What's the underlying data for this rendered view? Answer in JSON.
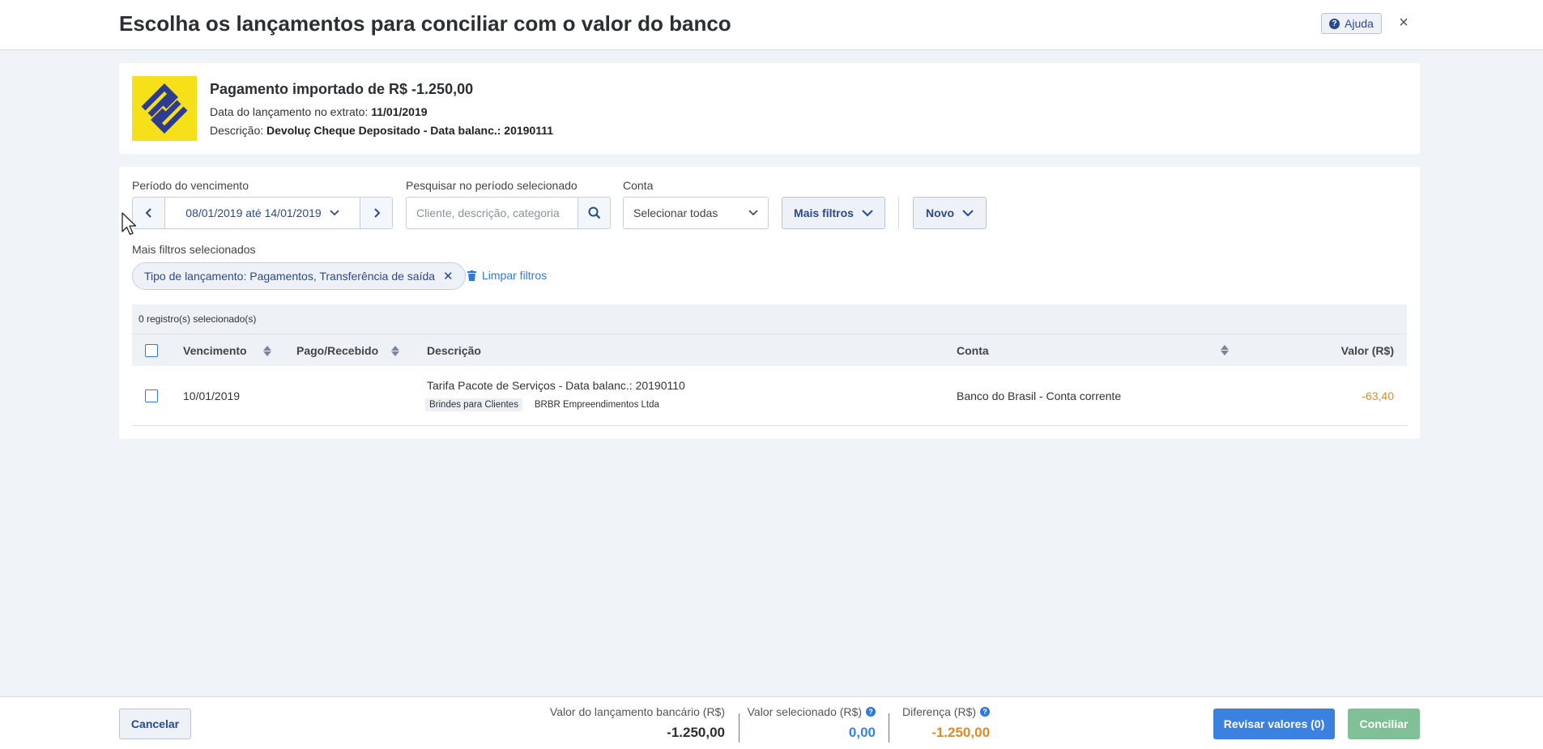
{
  "header": {
    "title": "Escolha os lançamentos para conciliar com o valor do banco",
    "help_label": "Ajuda",
    "close_glyph": "×"
  },
  "import": {
    "title": "Pagamento importado de R$ -1.250,00",
    "date_label": "Data do lançamento no extrato:",
    "date_value": "11/01/2019",
    "desc_label": "Descrição:",
    "desc_value": "Devoluç Cheque Depositado - Data balanc.: 20190111",
    "logo_icon": "banco-do-brasil-logo",
    "logo_colors": {
      "background": "#f5e01a",
      "mark": "#2e3c8f"
    }
  },
  "filters": {
    "period_label": "Período do vencimento",
    "period_value": "08/01/2019 até 14/01/2019",
    "search_label": "Pesquisar no período selecionado",
    "search_placeholder": "Cliente, descrição, categoria",
    "account_label": "Conta",
    "account_value": "Selecionar todas",
    "more_filters_label": "Mais filtros",
    "new_label": "Novo",
    "selected_filters_label": "Mais filtros selecionados",
    "chip_label": "Tipo de lançamento: Pagamentos, Transferência de saída",
    "clear_label": "Limpar filtros"
  },
  "table": {
    "selected_count": "0 registro(s) selecionado(s)",
    "columns": {
      "due": "Vencimento",
      "paid": "Pago/Recebido",
      "description": "Descrição",
      "account": "Conta",
      "value": "Valor (R$)"
    },
    "rows": [
      {
        "due": "10/01/2019",
        "paid": "",
        "description": "Tarifa Pacote de Serviços - Data balanc.: 20190110",
        "tags": [
          "Brindes para Clientes",
          "BRBR Empreendimentos Ltda"
        ],
        "account": "Banco do Brasil - Conta corrente",
        "value": "-63,40"
      }
    ]
  },
  "footer": {
    "cancel_label": "Cancelar",
    "bank_value_label": "Valor do lançamento bancário (R$)",
    "bank_value": "-1.250,00",
    "selected_value_label": "Valor selecionado (R$)",
    "selected_value": "0,00",
    "difference_label": "Diferença (R$)",
    "difference_value": "-1.250,00",
    "review_label": "Revisar valores (0)",
    "reconcile_label": "Conciliar"
  },
  "colors": {
    "accent": "#2f7ad8",
    "primary_dark": "#2a4a8a",
    "negative": "#e08a1e",
    "success_disabled": "#7fc096",
    "background": "#f0f3f8"
  }
}
